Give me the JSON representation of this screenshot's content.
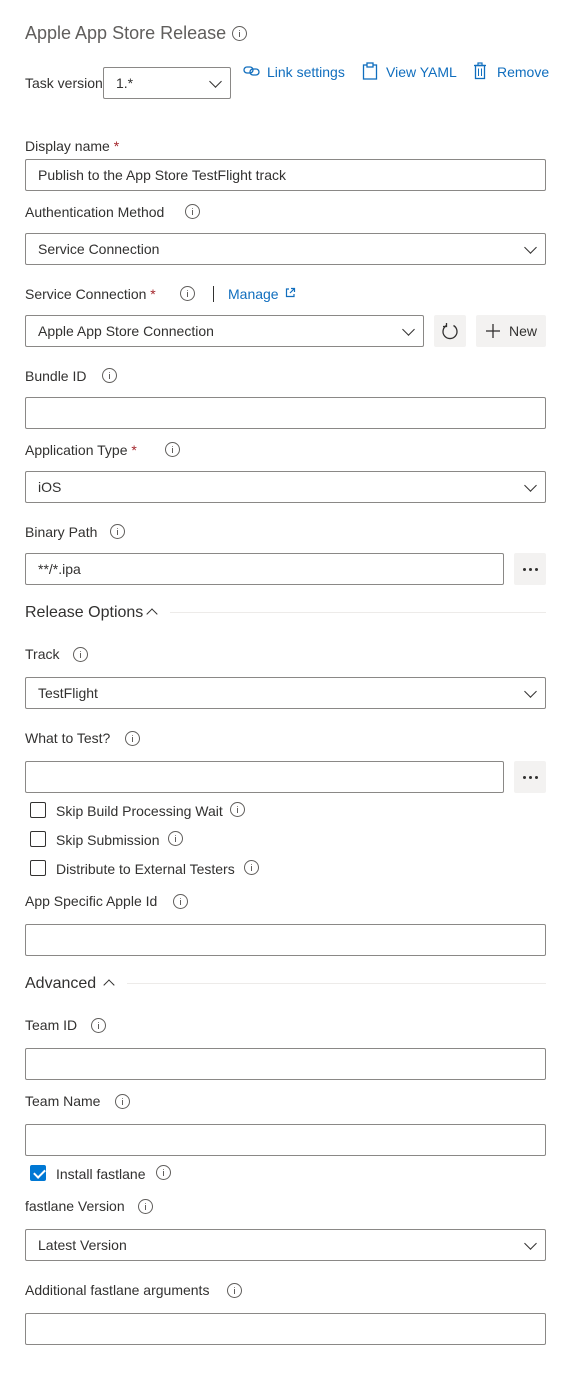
{
  "header": {
    "title": "Apple App Store Release",
    "task_version_label": "Task version",
    "task_version_value": "1.*",
    "link_settings": "Link settings",
    "view_yaml": "View YAML",
    "remove": "Remove"
  },
  "fields": {
    "display_name_label": "Display name",
    "display_name_value": "Publish to the App Store TestFlight track",
    "auth_method_label": "Authentication Method",
    "auth_method_value": "Service Connection",
    "service_connection_label": "Service Connection",
    "manage": "Manage",
    "service_connection_value": "Apple App Store Connection",
    "new_button": "New",
    "bundle_id_label": "Bundle ID",
    "bundle_id_value": "",
    "app_type_label": "Application Type",
    "app_type_value": "iOS",
    "binary_path_label": "Binary Path",
    "binary_path_value": "**/*.ipa"
  },
  "release_options": {
    "heading": "Release Options",
    "track_label": "Track",
    "track_value": "TestFlight",
    "what_to_test_label": "What to Test?",
    "what_to_test_value": "",
    "skip_build_wait": "Skip Build Processing Wait",
    "skip_submission": "Skip Submission",
    "distribute_external": "Distribute to External Testers",
    "app_specific_id_label": "App Specific Apple Id",
    "app_specific_id_value": ""
  },
  "advanced": {
    "heading": "Advanced",
    "team_id_label": "Team ID",
    "team_id_value": "",
    "team_name_label": "Team Name",
    "team_name_value": "",
    "install_fastlane": "Install fastlane",
    "fastlane_version_label": "fastlane Version",
    "fastlane_version_value": "Latest Version",
    "additional_args_label": "Additional fastlane arguments",
    "additional_args_value": ""
  },
  "colors": {
    "accent": "#0078d4",
    "link": "#106ebe",
    "required": "#a4262c"
  }
}
